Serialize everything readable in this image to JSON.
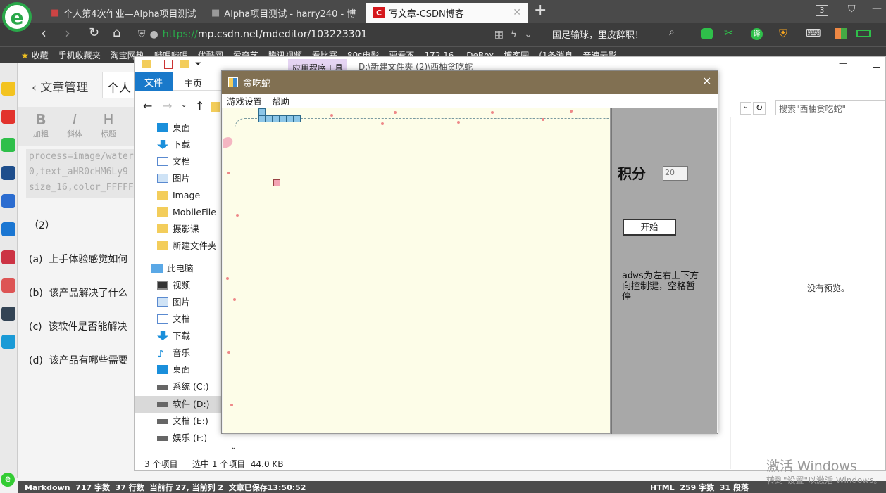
{
  "browser": {
    "tabs": [
      {
        "title": "个人第4次作业—Alpha项目测试"
      },
      {
        "title": "Alpha项目测试 - harry240 - 博"
      },
      {
        "title": "写文章-CSDN博客"
      }
    ],
    "new_tab": "+",
    "tab_count": "3",
    "url_scheme": "https://",
    "url_rest": "mp.csdn.net/mdeditor/103223301",
    "search_hint": "国足输球，里皮辞职！",
    "bookmarks": [
      "收藏",
      "手机收藏夹",
      "淘宝网热",
      "哔哩哔哩",
      "优酷网",
      "爱奇艺",
      "腾讯视频",
      "看比赛",
      "80s电影",
      "要看不",
      "172.16.",
      "DeBox",
      "博客园",
      "(1条消息",
      "音速云影"
    ]
  },
  "editor": {
    "back_label": "文章管理",
    "title_value": "个人",
    "toolbar": [
      {
        "glyph": "B",
        "label": "加粗"
      },
      {
        "glyph": "I",
        "label": "斜体"
      },
      {
        "glyph": "H",
        "label": "标题"
      }
    ],
    "code_lines": [
      "process=image/waterm",
      "0,text_aHR0cHM6Ly9",
      "size_16,color_FFFFFF"
    ],
    "paragraph_num": "（2）",
    "questions": [
      {
        "num": "(a)",
        "text": "上手体验感觉如何"
      },
      {
        "num": "(b)",
        "text": "该产品解决了什么"
      },
      {
        "num": "(c)",
        "text": "该软件是否能解决"
      },
      {
        "num": "(d)",
        "text": "该产品有哪些需要"
      }
    ],
    "status": {
      "left": "Markdown  717 字数  37 行数  当前行 27, 当前列 2  文章已保存13:50:52",
      "right": "HTML  259 字数  31 段落"
    }
  },
  "explorer": {
    "context_tab": "应用程序工具",
    "path_title": "D:\\新建文件夹 (2)\\西柚贪吃蛇",
    "ribbon": {
      "file": "文件",
      "home": "主页"
    },
    "search_placeholder": "搜索\"西柚贪吃蛇\"",
    "preview_text": "没有预览。",
    "quick_access": [
      "桌面",
      "下载",
      "文档",
      "图片",
      "Image",
      "MobileFile",
      "摄影课",
      "新建文件夹"
    ],
    "this_pc": "此电脑",
    "pc_items": [
      "视频",
      "图片",
      "文档",
      "下载",
      "音乐",
      "桌面",
      "系统 (C:)",
      "软件 (D:)",
      "文档 (E:)",
      "娱乐 (F:)"
    ],
    "status_items": "3 个项目",
    "status_selected": "选中 1 个项目  44.0 KB"
  },
  "snake": {
    "title": "贪吃蛇",
    "menu": [
      "游戏设置",
      "帮助"
    ],
    "score_label": "积分",
    "score_value": "20",
    "start_button": "开始",
    "help_text": "adws为左右上下方向控制键，空格暂停"
  },
  "watermark": {
    "line1": "激活 Windows",
    "line2": "转到\"设置\"以激活 Windows。"
  },
  "colors": {
    "browser_dark": "#3c3c3c",
    "explorer_blue": "#1979ca",
    "snake_title": "#817052",
    "board_bg": "#fdfde8",
    "snake_body": "#8cc6e8",
    "food": "#f4a4b4"
  }
}
